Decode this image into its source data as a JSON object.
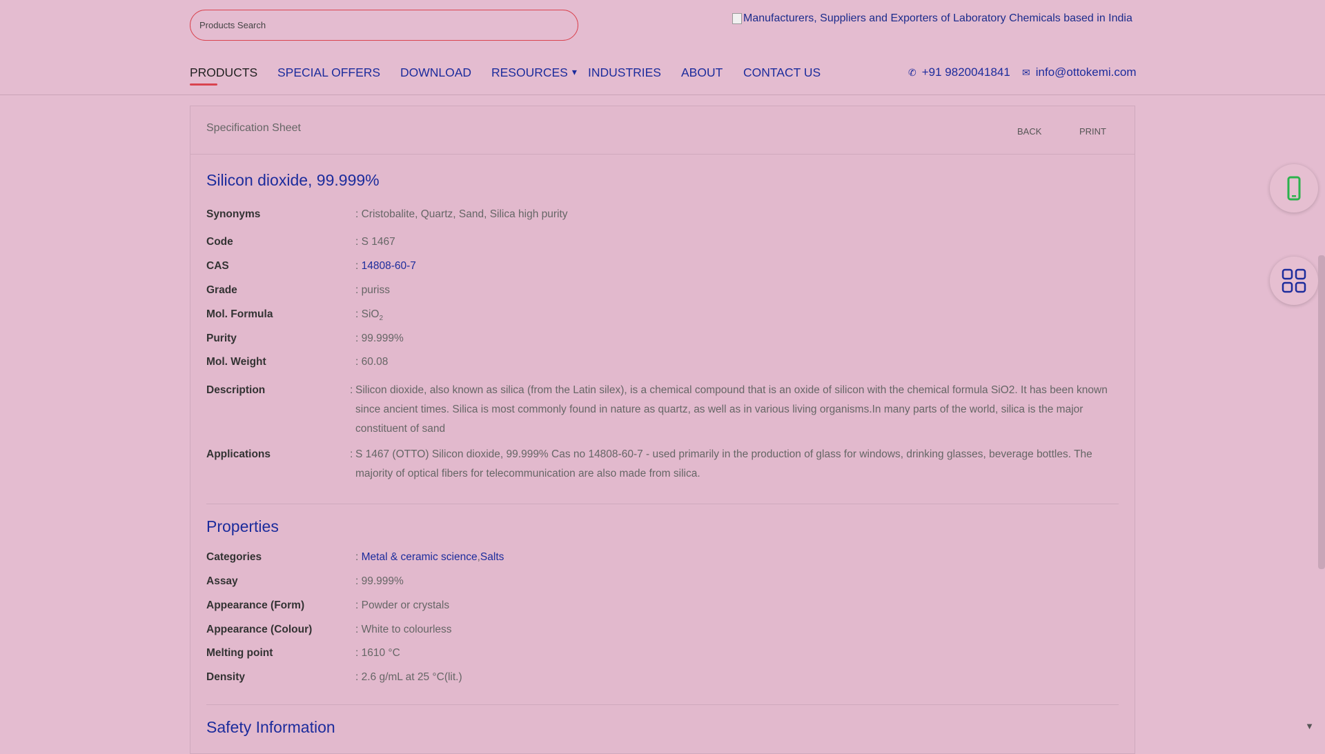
{
  "search": {
    "placeholder": "Products Search"
  },
  "header": {
    "logo_alt": "Manufacturers, Suppliers and Exporters of Laboratory Chemicals based in India"
  },
  "nav": {
    "items": [
      {
        "label": "PRODUCTS"
      },
      {
        "label": "SPECIAL OFFERS"
      },
      {
        "label": "DOWNLOAD"
      },
      {
        "label": "RESOURCES"
      },
      {
        "label": "INDUSTRIES"
      },
      {
        "label": "ABOUT"
      },
      {
        "label": "CONTACT US"
      }
    ],
    "phone": "+91 9820041841",
    "email": "info@ottokemi.com"
  },
  "panel": {
    "title": "Specification Sheet",
    "back_label": "BACK",
    "print_label": "PRINT"
  },
  "product": {
    "name": "Silicon dioxide, 99.999%",
    "synonyms_label": "Synonyms",
    "synonyms": ": Cristobalite, Quartz, Sand, Silica high purity",
    "code_label": "Code",
    "code": ": S 1467",
    "cas_label": "CAS",
    "cas": "14808-60-7",
    "grade_label": "Grade",
    "grade": ": puriss",
    "formula_label": "Mol. Formula",
    "formula_main": "SiO",
    "formula_sub": "2",
    "purity_label": "Purity",
    "purity": ": 99.999%",
    "weight_label": "Mol. Weight",
    "weight": ": 60.08",
    "description_label": "Description",
    "description": "Silicon dioxide, also known as silica (from the Latin silex), is a chemical compound that is an oxide of silicon with the chemical formula SiO2. It has been known since ancient times. Silica is most commonly found in nature as quartz, as well as in various living organisms.In many parts of the world, silica is the major constituent of sand",
    "applications_label": "Applications",
    "applications": "S 1467 (OTTO) Silicon dioxide, 99.999% Cas no 14808-60-7 - used primarily in the production of glass for windows, drinking glasses, beverage bottles. The majority of optical fibers for telecommunication are also made from silica."
  },
  "properties": {
    "heading": "Properties",
    "categories_label": "Categories",
    "category_1": "Metal & ceramic science",
    "category_2": "Salts",
    "assay_label": "Assay",
    "assay": ": 99.999%",
    "form_label": "Appearance (Form)",
    "form": ": Powder or crystals",
    "colour_label": "Appearance (Colour)",
    "colour": ": White to colourless",
    "melting_label": "Melting point",
    "melting": ": 1610 °C",
    "density_label": "Density",
    "density": ": 2.6 g/mL at 25 °C(lit.)"
  },
  "safety": {
    "heading": "Safety Information"
  },
  "icons": {
    "phone": "phone-icon",
    "email": "envelope-icon",
    "whatsapp": "whatsapp-icon",
    "grid": "grid-icon"
  },
  "colors": {
    "accent": "#d9434f",
    "link": "#1c2c9c",
    "background": "#e4bcd0"
  }
}
